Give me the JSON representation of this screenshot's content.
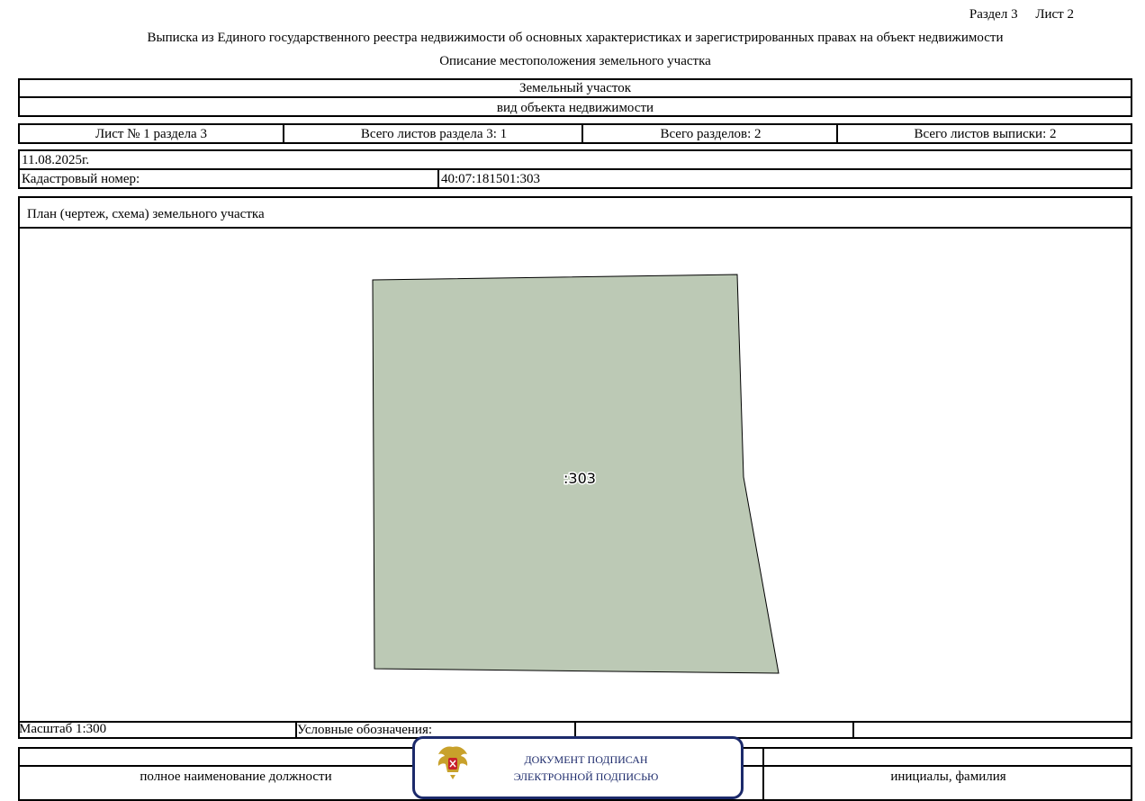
{
  "header": {
    "section": "Раздел 3",
    "sheet": "Лист 2",
    "title": "Выписка из Единого государственного реестра недвижимости об основных характеристиках и зарегистрированных правах на объект недвижимости",
    "subtitle": "Описание местоположения земельного участка"
  },
  "object": {
    "type_value": "Земельный участок",
    "type_caption": "вид объекта недвижимости"
  },
  "sheet_info": {
    "sheet_no": "Лист № 1 раздела 3",
    "total_section_sheets": "Всего листов раздела 3: 1",
    "total_sections": "Всего разделов: 2",
    "total_extract_sheets": "Всего листов выписки: 2"
  },
  "meta": {
    "date": "11.08.2025г.",
    "cadastral_label": "Кадастровый номер:",
    "cadastral_value": "40:07:181501:303"
  },
  "plan": {
    "title": "План (чертеж, схема) земельного участка",
    "parcel_label": ":303",
    "parcel_fill": "#bcc9b5"
  },
  "legend": {
    "scale": "Масштаб 1:300",
    "legend_label": "Условные обозначения:"
  },
  "signature": {
    "position_caption": "полное наименование должности",
    "name_caption": "инициалы, фамилия",
    "stamp_line1": "ДОКУМЕНТ ПОДПИСАН",
    "stamp_line2": "ЭЛЕКТРОННОЙ ПОДПИСЬЮ",
    "stamp_color": "#1c2a6b",
    "emblem_icon": "coat-of-arms-icon"
  }
}
